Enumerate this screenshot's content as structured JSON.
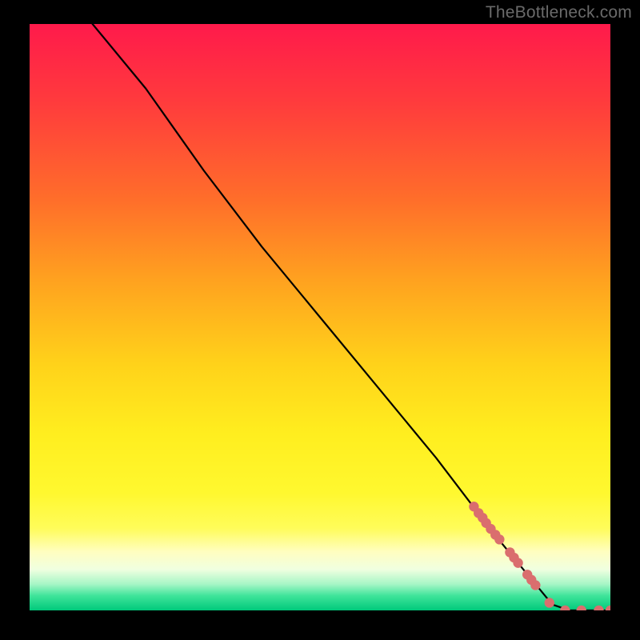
{
  "watermark": "TheBottleneck.com",
  "chart_data": {
    "type": "line",
    "title": "",
    "xlabel": "",
    "ylabel": "",
    "xlim": [
      0,
      100
    ],
    "ylim": [
      0,
      100
    ],
    "grid": false,
    "legend": false,
    "gradient_stops": [
      {
        "offset": 0.0,
        "color": "#ff1a4b"
      },
      {
        "offset": 0.13,
        "color": "#ff3a3d"
      },
      {
        "offset": 0.3,
        "color": "#ff6e2a"
      },
      {
        "offset": 0.44,
        "color": "#ffa31f"
      },
      {
        "offset": 0.58,
        "color": "#ffd21a"
      },
      {
        "offset": 0.7,
        "color": "#ffee1f"
      },
      {
        "offset": 0.8,
        "color": "#fff82f"
      },
      {
        "offset": 0.86,
        "color": "#fffc5a"
      },
      {
        "offset": 0.9,
        "color": "#fffec0"
      },
      {
        "offset": 0.93,
        "color": "#f0ffe0"
      },
      {
        "offset": 0.955,
        "color": "#a7f6c6"
      },
      {
        "offset": 0.975,
        "color": "#3fe49a"
      },
      {
        "offset": 1.0,
        "color": "#00c97b"
      }
    ],
    "series": [
      {
        "name": "bottleneck-curve",
        "type": "line",
        "color": "#000000",
        "x": [
          0,
          10,
          20,
          25,
          30,
          40,
          50,
          60,
          70,
          80,
          85,
          90,
          93,
          97,
          100
        ],
        "y": [
          112,
          101,
          89,
          82,
          75,
          62,
          50,
          38,
          26,
          13,
          7,
          1,
          0,
          0,
          0
        ]
      },
      {
        "name": "data-points",
        "type": "scatter",
        "color": "#da6e6e",
        "x": [
          76.5,
          77.3,
          78.0,
          78.6,
          79.4,
          80.2,
          80.9,
          82.7,
          83.4,
          84.1,
          85.7,
          86.4,
          87.1,
          89.5,
          92.2,
          95.0,
          98.0,
          100.0
        ],
        "y": [
          17.7,
          16.6,
          15.8,
          14.9,
          13.9,
          12.9,
          12.1,
          9.9,
          9.0,
          8.1,
          6.1,
          5.2,
          4.3,
          1.3,
          0.0,
          0.0,
          0.0,
          0.0
        ]
      }
    ]
  }
}
